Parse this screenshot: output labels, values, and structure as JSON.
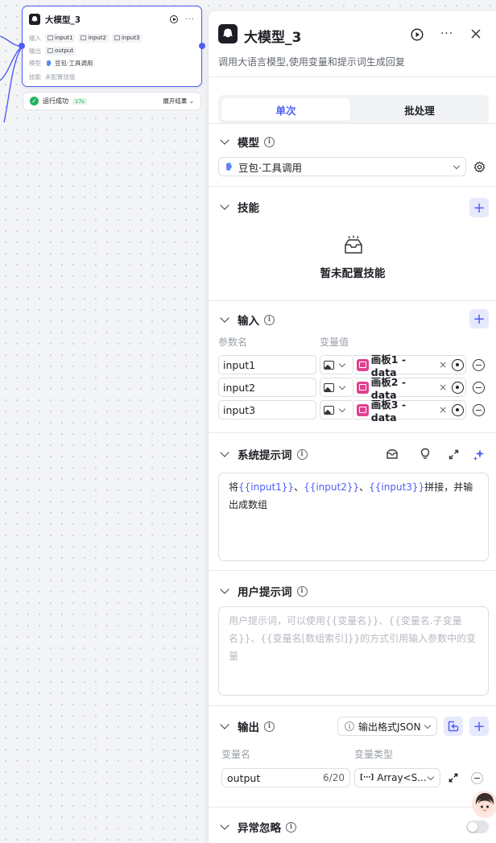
{
  "canvas": {
    "node": {
      "title": "大模型_3",
      "input_label": "输入",
      "inputs": [
        "input1",
        "input2",
        "input3"
      ],
      "output_label": "输出",
      "output": "output",
      "model_label": "模型",
      "model": "豆包·工具调用",
      "skills_label": "技能",
      "skills_value": "未配置技能"
    },
    "run": {
      "status": "运行成功",
      "badge": "17s",
      "expand": "展开结果"
    }
  },
  "panel": {
    "title": "大模型_3",
    "description": "调用大语言模型,使用变量和提示词生成回复",
    "tabs": [
      "单次",
      "批处理"
    ],
    "active_tab": "单次",
    "model": {
      "header": "模型",
      "selected": "豆包·工具调用"
    },
    "skills": {
      "header": "技能",
      "empty_text": "暂未配置技能"
    },
    "inputs": {
      "header": "输入",
      "col_name": "参数名",
      "col_value": "变量值",
      "rows": [
        {
          "name": "input1",
          "ref": "画板1 - data"
        },
        {
          "name": "input2",
          "ref": "画板2 - data"
        },
        {
          "name": "input3",
          "ref": "画板3 - data"
        }
      ]
    },
    "system_prompt": {
      "header": "系统提示词",
      "parts": [
        "将",
        "{{input1}}",
        "、",
        "{{input2}}",
        "、",
        "{{input3}}",
        "拼接，并输出成数组"
      ]
    },
    "user_prompt": {
      "header": "用户提示词",
      "placeholder": "用户提示词，可以使用{{变量名}}、{{变量名.子变量名}}、{{变量名[数组索引]}}的方式引用输入参数中的变量"
    },
    "output": {
      "header": "输出",
      "format": "输出格式JSON",
      "col_name": "变量名",
      "col_type": "变量类型",
      "var_name": "output",
      "counter": "6/20",
      "var_type": "Array<S..."
    },
    "exception": {
      "header": "异常忽略"
    }
  },
  "colors": {
    "accent": "#4e5ef4",
    "success": "#22b35e",
    "ref_icon": "#e0408e"
  }
}
